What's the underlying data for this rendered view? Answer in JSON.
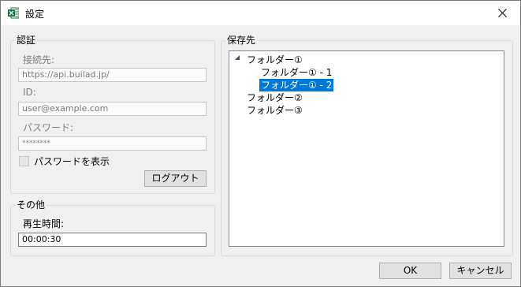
{
  "window": {
    "title": "設定"
  },
  "auth": {
    "legend": "認証",
    "endpoint_label": "接続先:",
    "endpoint_value": "https://api.builad.jp/",
    "id_label": "ID:",
    "id_value": "user@example.com",
    "password_label": "パスワード:",
    "password_value": "********",
    "show_password_label": "パスワードを表示",
    "logout_label": "ログアウト"
  },
  "other": {
    "legend": "その他",
    "playtime_label": "再生時間:",
    "playtime_value": "00:00:30"
  },
  "save_location": {
    "legend": "保存先",
    "tree": [
      {
        "label": "フォルダー①",
        "level": 0,
        "expanded": true,
        "selected": false
      },
      {
        "label": "フォルダー① - 1",
        "level": 1,
        "selected": false
      },
      {
        "label": "フォルダー① - 2",
        "level": 1,
        "selected": true
      },
      {
        "label": "フォルダー②",
        "level": 0,
        "selected": false
      },
      {
        "label": "フォルダー③",
        "level": 0,
        "selected": false
      }
    ]
  },
  "footer": {
    "ok_label": "OK",
    "cancel_label": "キャンセル"
  },
  "colors": {
    "accent": "#0078d7",
    "excel_green": "#1d6f42"
  },
  "icons": {
    "app": "excel-icon",
    "close": "close-icon",
    "expander": "expanded-triangle-icon"
  }
}
